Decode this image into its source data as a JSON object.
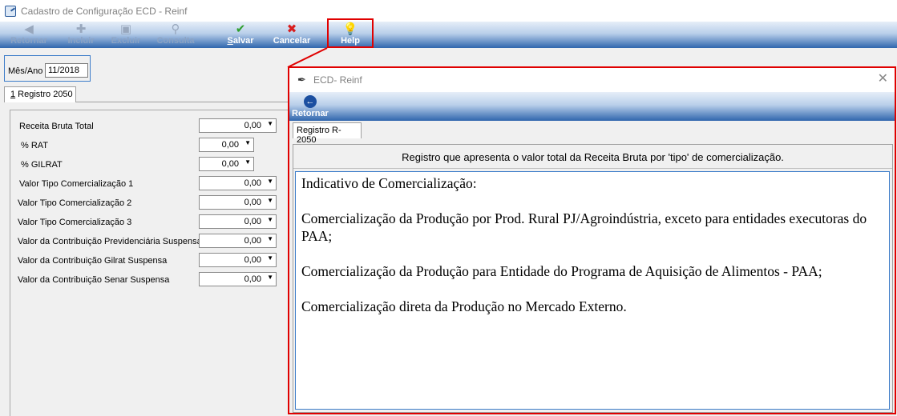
{
  "window": {
    "title": "Cadastro de Configuração ECD - Reinf"
  },
  "toolbar": {
    "retornar": "Retornar",
    "incluir": "Incluir",
    "excluir": "Excluir",
    "consulta": "Consulta",
    "salvar_u": "S",
    "salvar_rest": "alvar",
    "cancelar": "Cancelar",
    "help": "Help"
  },
  "period": {
    "label": "Mês/Ano",
    "value": "11/2018"
  },
  "tab": {
    "accel": "1",
    "label": " Registro 2050"
  },
  "form": {
    "fields": [
      {
        "label": "Receita Bruta Total",
        "value": "0,00"
      },
      {
        "label": "% RAT",
        "value": "0,00"
      },
      {
        "label": "% GILRAT",
        "value": "0,00"
      },
      {
        "label": "Valor Tipo Comercialização 1",
        "value": "0,00"
      },
      {
        "label": "Valor Tipo Comercialização 2",
        "value": "0,00"
      },
      {
        "label": "Valor Tipo Comercialização 3",
        "value": "0,00"
      },
      {
        "label": "Valor da Contribuição Previdenciária Suspensa",
        "value": "0,00"
      },
      {
        "label": "Valor da Contribuição Gilrat Suspensa",
        "value": "0,00"
      },
      {
        "label": "Valor da Contribuição Senar Suspensa",
        "value": "0,00"
      }
    ]
  },
  "popup": {
    "title": "ECD- Reinf",
    "back_label": "Retornar",
    "tab_label": "Registro R-2050",
    "header": "Registro que apresenta o valor total da Receita Bruta por 'tipo' de comercialização.",
    "memo": [
      "Indicativo de Comercialização:",
      "Comercialização da Produção por Prod. Rural PJ/Agroindústria, exceto para entidades executoras do PAA;",
      "Comercialização da Produção para Entidade do Programa de Aquisição de Alimentos - PAA;",
      "Comercialização direta da Produção no Mercado Externo."
    ]
  },
  "colors": {
    "highlight": "#e00000",
    "toolbar_dark": "#2f66ad",
    "focus_border": "#3d7cc9"
  }
}
